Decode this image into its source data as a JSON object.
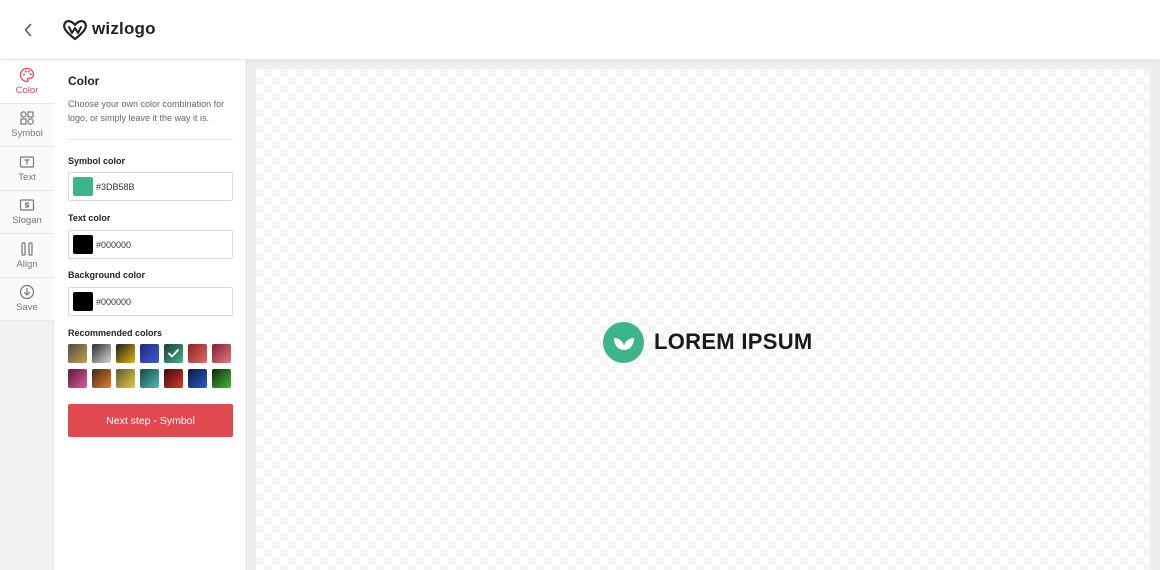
{
  "header": {
    "brand": "wizlogo",
    "back_icon": "chevron-left-icon",
    "logo_icon": "heart-logo-icon"
  },
  "rail": {
    "items": [
      {
        "label": "Color",
        "icon": "palette-icon",
        "active": true
      },
      {
        "label": "Symbol",
        "icon": "shapes-icon",
        "active": false
      },
      {
        "label": "Text",
        "icon": "text-box-icon",
        "active": false
      },
      {
        "label": "Slogan",
        "icon": "slogan-box-icon",
        "active": false
      },
      {
        "label": "Align",
        "icon": "align-icon",
        "active": false
      },
      {
        "label": "Save",
        "icon": "download-icon",
        "active": false
      }
    ]
  },
  "panel": {
    "title": "Color",
    "description": "Choose your own color combination for logo, or simply leave it the way it is.",
    "symbol_color": {
      "label": "Symbol color",
      "value": "#3DB58B"
    },
    "text_color": {
      "label": "Text color",
      "value": "#000000"
    },
    "background_color": {
      "label": "Background color",
      "value": "#000000"
    },
    "recommended": {
      "label": "Recommended colors",
      "swatches": [
        {
          "from": "#4a4a4a",
          "to": "#c8a24a",
          "selected": false
        },
        {
          "from": "#2b2b2b",
          "to": "#d9d9d9",
          "selected": false
        },
        {
          "from": "#1e1e1e",
          "to": "#e3b70c",
          "selected": false
        },
        {
          "from": "#1f2a7a",
          "to": "#3d5ad4",
          "selected": false
        },
        {
          "from": "#1f3d33",
          "to": "#3DB58B",
          "selected": true
        },
        {
          "from": "#8f2020",
          "to": "#e36a6a",
          "selected": false
        },
        {
          "from": "#7a1f3a",
          "to": "#e9797b",
          "selected": false
        },
        {
          "from": "#5a1a3a",
          "to": "#e05aa0",
          "selected": false
        },
        {
          "from": "#3b2a1a",
          "to": "#ef7a2a",
          "selected": false
        },
        {
          "from": "#5a5a2a",
          "to": "#e8c84a",
          "selected": false
        },
        {
          "from": "#16444a",
          "to": "#4dbfb0",
          "selected": false
        },
        {
          "from": "#3a0a0a",
          "to": "#d33a2a",
          "selected": false
        },
        {
          "from": "#0a1a3a",
          "to": "#2a5ad4",
          "selected": false
        },
        {
          "from": "#0a2a0a",
          "to": "#4ab83a",
          "selected": false
        }
      ]
    },
    "next_button": "Next step - Symbol"
  },
  "preview": {
    "text": "LOREM IPSUM",
    "symbol_color": "#3DB58B",
    "text_color": "#1a1a1a",
    "symbol_icon": "leaf-icon"
  },
  "colors": {
    "accent": "#e04a4f"
  }
}
